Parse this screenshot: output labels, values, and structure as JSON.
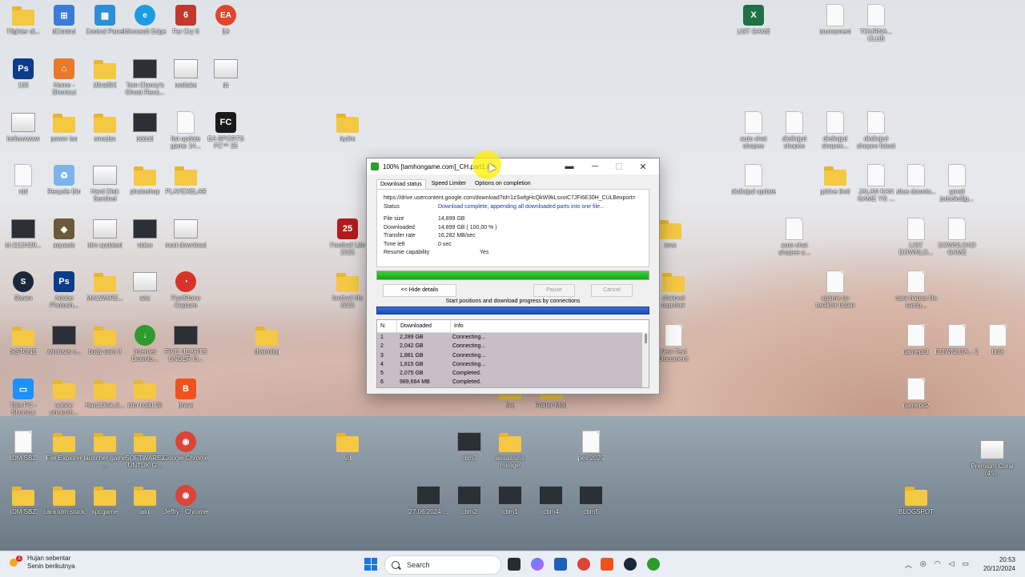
{
  "desktop": {
    "icons": [
      {
        "label": "Tfighter di...",
        "kind": "folder"
      },
      {
        "label": "dControl",
        "kind": "tile",
        "color": "#3a7bd5",
        "glyph": "⊞"
      },
      {
        "label": "Control Panel",
        "kind": "tile",
        "color": "#2a8fd6",
        "glyph": "▦"
      },
      {
        "label": "Microsoft Edge",
        "kind": "circ",
        "color": "#1b9de2",
        "glyph": "e"
      },
      {
        "label": "Far Cry 6",
        "kind": "tile",
        "color": "#c0392b",
        "glyph": "6"
      },
      {
        "label": "EA",
        "kind": "circ",
        "color": "#e0462b",
        "glyph": "EA"
      },
      {
        "label": "130",
        "kind": "tile",
        "color": "#0b3c8a",
        "glyph": "Ps"
      },
      {
        "label": "Home - Shortcut",
        "kind": "tile",
        "color": "#e87a2a",
        "glyph": "⌂"
      },
      {
        "label": "UltraISO",
        "kind": "folder"
      },
      {
        "label": "Tom Clancy's Ghost Reco...",
        "kind": "shot"
      },
      {
        "label": "realtake",
        "kind": "shot2"
      },
      {
        "label": "dz",
        "kind": "shot2"
      },
      {
        "label": "bellwwwww",
        "kind": "shot2"
      },
      {
        "label": "power iso",
        "kind": "folder"
      },
      {
        "label": "smadav",
        "kind": "folder"
      },
      {
        "label": "ddddd",
        "kind": "shot"
      },
      {
        "label": "list update game 14...",
        "kind": "doc"
      },
      {
        "label": "EA SPORTS FC™ 25",
        "kind": "tile",
        "color": "#1a1a1a",
        "glyph": "FC"
      },
      {
        "label": "hydro",
        "kind": "folder"
      },
      {
        "label": "auto chat shopee",
        "kind": "doc"
      },
      {
        "label": "dkdkrjpd shopee",
        "kind": "doc"
      },
      {
        "label": "dkdkrjpd shopee...",
        "kind": "doc"
      },
      {
        "label": "dkdkrjpd shopee latest",
        "kind": "doc"
      },
      {
        "label": "rdd",
        "kind": "doc"
      },
      {
        "label": "Recycle Bin",
        "kind": "tile",
        "color": "#7db3e8",
        "glyph": "♻"
      },
      {
        "label": "Hard Disk Sentinel",
        "kind": "shot2"
      },
      {
        "label": "photoshop",
        "kind": "folder"
      },
      {
        "label": "PLAYEXELAR",
        "kind": "folder"
      },
      {
        "label": "dkdkrjpd update",
        "kind": "doc"
      },
      {
        "label": "gdrive limit",
        "kind": "folder"
      },
      {
        "label": "JALAN KAN GAME YG ...",
        "kind": "doc"
      },
      {
        "label": "situs downlo...",
        "kind": "doc"
      },
      {
        "label": "gmail jsdsdkdfjg...",
        "kind": "doc"
      },
      {
        "label": "id-1113420...",
        "kind": "shot"
      },
      {
        "label": "aquasis",
        "kind": "tile",
        "color": "#6b5a3a",
        "glyph": "◆"
      },
      {
        "label": "idm updated",
        "kind": "shot2"
      },
      {
        "label": "video",
        "kind": "shot"
      },
      {
        "label": "mod download",
        "kind": "shot2"
      },
      {
        "label": "Football Life 2025",
        "kind": "tile",
        "color": "#b01c1c",
        "glyph": "25"
      },
      {
        "label": "revo",
        "kind": "folder"
      },
      {
        "label": "auto chat shopee u...",
        "kind": "doc"
      },
      {
        "label": "LIST DOWNLO...",
        "kind": "doc"
      },
      {
        "label": "DOWNLOAD GAME",
        "kind": "doc"
      },
      {
        "label": "Steam",
        "kind": "circ",
        "color": "#1b2838",
        "glyph": "S"
      },
      {
        "label": "Adobe Photosh...",
        "kind": "tile",
        "color": "#0b3c8a",
        "glyph": "Ps"
      },
      {
        "label": "MALWARE...",
        "kind": "folder"
      },
      {
        "label": "aaa",
        "kind": "shot2"
      },
      {
        "label": "FastStone Capture",
        "kind": "circ",
        "color": "#d9322b",
        "glyph": "◔"
      },
      {
        "label": "football life 2025",
        "kind": "folder"
      },
      {
        "label": "chained together",
        "kind": "folder"
      },
      {
        "label": "xgame pc terakhir bulan",
        "kind": "doc"
      },
      {
        "label": "cara hapus file samp...",
        "kind": "doc"
      },
      {
        "label": "faSTONE",
        "kind": "folder"
      },
      {
        "label": "windows c...",
        "kind": "shot"
      },
      {
        "label": "body cam 3",
        "kind": "folder"
      },
      {
        "label": "Internet Downlo...",
        "kind": "circ",
        "color": "#2e9b2e",
        "glyph": "↓"
      },
      {
        "label": "FIVE HEARTS UNDER O...",
        "kind": "shot"
      },
      {
        "label": "charming",
        "kind": "folder"
      },
      {
        "label": "New Text Document",
        "kind": "doc"
      },
      {
        "label": "gamepc1",
        "kind": "doc"
      },
      {
        "label": "DOWNLOA... 2",
        "kind": "doc"
      },
      {
        "label": "bola",
        "kind": "doc"
      },
      {
        "label": "This PC - Shortcut",
        "kind": "tile",
        "color": "#1e90ff",
        "glyph": "▭"
      },
      {
        "label": "adobe photosh...",
        "kind": "folder"
      },
      {
        "label": "Hard.Disk.S...",
        "kind": "folder"
      },
      {
        "label": "idm build 20",
        "kind": "folder"
      },
      {
        "label": "Brave",
        "kind": "tile",
        "color": "#f0521c",
        "glyph": "B"
      },
      {
        "label": "five",
        "kind": "folder"
      },
      {
        "label": "Folder Mod",
        "kind": "folder"
      },
      {
        "label": "gamepc2",
        "kind": "doc"
      },
      {
        "label": "IDM SBZ",
        "kind": "doc"
      },
      {
        "label": "File Explorer",
        "kind": "folder"
      },
      {
        "label": "launcher game ...",
        "kind": "folder"
      },
      {
        "label": "SOFTWARE2 UNTUK G...",
        "kind": "folder"
      },
      {
        "label": "Google Chrome",
        "kind": "circ",
        "color": "#db4437",
        "glyph": "◉"
      },
      {
        "label": "vd",
        "kind": "folder"
      },
      {
        "label": "cbm3",
        "kind": "shot"
      },
      {
        "label": "assassins mirage",
        "kind": "folder"
      },
      {
        "label": "pes 2025",
        "kind": "doc"
      },
      {
        "label": "Premium Coral (45...",
        "kind": "shot2"
      },
      {
        "label": "IDM SBZ",
        "kind": "folder"
      },
      {
        "label": "cara idm stuck",
        "kind": "folder"
      },
      {
        "label": "xpcgame",
        "kind": "folder"
      },
      {
        "label": "alo",
        "kind": "folder"
      },
      {
        "label": "Jeffry - Chrome",
        "kind": "circ",
        "color": "#db4437",
        "glyph": "◉"
      },
      {
        "label": "27.06.2024 ...",
        "kind": "shot"
      },
      {
        "label": "cbm2",
        "kind": "shot"
      },
      {
        "label": "cbm1",
        "kind": "shot"
      },
      {
        "label": "cbm4",
        "kind": "shot"
      },
      {
        "label": "cbm5",
        "kind": "shot"
      },
      {
        "label": "BLOGSPOT",
        "kind": "folder"
      },
      {
        "label": "LIST GAME",
        "kind": "tile",
        "color": "#1e7145",
        "glyph": "X"
      },
      {
        "label": "tournament",
        "kind": "doc"
      },
      {
        "label": "TOURNA... CLUB",
        "kind": "doc"
      }
    ]
  },
  "idm": {
    "title": "100% [tamhongame.com]_CH.part1.rar",
    "tabs": [
      "Download status",
      "Speed Limiter",
      "Options on completion"
    ],
    "url": "https://drive.usercontent.google.com/download?id=1zSwfgHcQkW9kLsxoiC7JFi6E30H_CULBexport=",
    "status_label": "Status",
    "status_value": "Download complete, appending all downloaded parts into one file...",
    "rows": [
      {
        "label": "File size",
        "value": "14,899  GB"
      },
      {
        "label": "Downloaded",
        "value": "14,899  GB  ( 100,00 % )"
      },
      {
        "label": "Transfer rate",
        "value": "16,282  MB/sec"
      },
      {
        "label": "Time left",
        "value": "0 sec"
      },
      {
        "label": "Resume capability",
        "value": "Yes"
      }
    ],
    "progress": 1.0,
    "hide_details": "<< Hide details",
    "pause": "Pause",
    "cancel": "Cancel",
    "conn_caption": "Start positions and download progress by connections",
    "table_headers": [
      "N.",
      "Downloaded",
      "Info"
    ],
    "connections": [
      {
        "n": "1",
        "downloaded": "2,289  GB",
        "info": "Connecting..."
      },
      {
        "n": "2",
        "downloaded": "2,042  GB",
        "info": "Connecting..."
      },
      {
        "n": "3",
        "downloaded": "1,881  GB",
        "info": "Connecting..."
      },
      {
        "n": "4",
        "downloaded": "1,815  GB",
        "info": "Connecting..."
      },
      {
        "n": "5",
        "downloaded": "2,075  GB",
        "info": "Completed."
      },
      {
        "n": "6",
        "downloaded": "989,664  MB",
        "info": "Completed."
      }
    ]
  },
  "taskbar": {
    "weather_title": "Hujan sebentar",
    "weather_sub": "Senin berikutnya",
    "weather_badge": "1",
    "search": "Search",
    "time": "20:53",
    "date": "20/12/2024"
  }
}
